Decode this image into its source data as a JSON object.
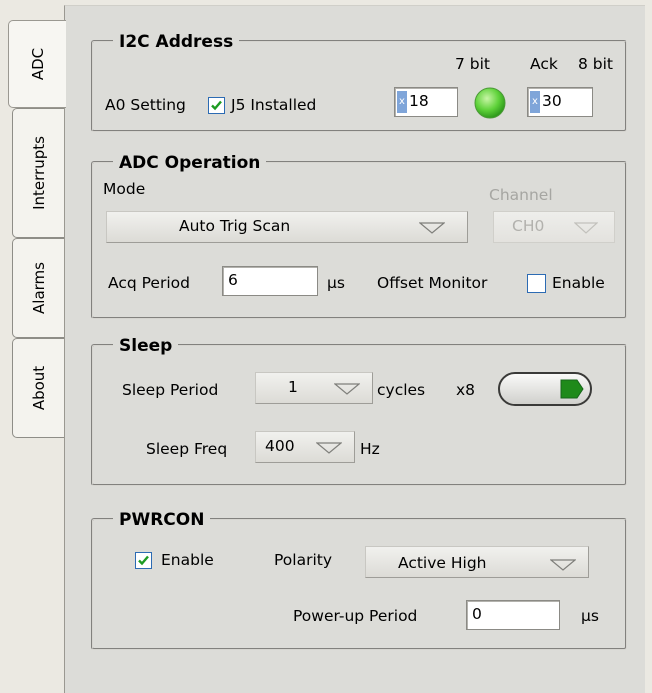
{
  "tabs": [
    {
      "label": "ADC",
      "active": true
    },
    {
      "label": "Interrupts",
      "active": false
    },
    {
      "label": "Alarms",
      "active": false
    },
    {
      "label": "About",
      "active": false
    }
  ],
  "i2c": {
    "title": "I2C Address",
    "a0_label": "A0 Setting",
    "j5_label": "J5 Installed",
    "j5_checked": true,
    "col_7bit": "7 bit",
    "col_ack": "Ack",
    "col_8bit": "8 bit",
    "radix": "x",
    "addr7": "18",
    "addr8": "30",
    "ack_color": "#5fd23a"
  },
  "adc": {
    "title": "ADC Operation",
    "mode_label": "Mode",
    "mode_value": "Auto Trig Scan",
    "channel_label": "Channel",
    "channel_value": "CH0",
    "acq_label": "Acq Period",
    "acq_value": "6",
    "acq_unit": "µs",
    "offset_label": "Offset Monitor",
    "offset_enable_label": "Enable",
    "offset_enable_checked": false
  },
  "sleep": {
    "title": "Sleep",
    "period_label": "Sleep Period",
    "period_value": "1",
    "cycles_label": "cycles",
    "mult_label": "x8",
    "freq_label": "Sleep Freq",
    "freq_value": "400",
    "freq_unit": "Hz",
    "led_color": "#1f8a1a"
  },
  "pwrcon": {
    "title": "PWRCON",
    "enable_label": "Enable",
    "enable_checked": true,
    "polarity_label": "Polarity",
    "polarity_value": "Active High",
    "powerup_label": "Power-up Period",
    "powerup_value": "0",
    "powerup_unit": "µs"
  }
}
